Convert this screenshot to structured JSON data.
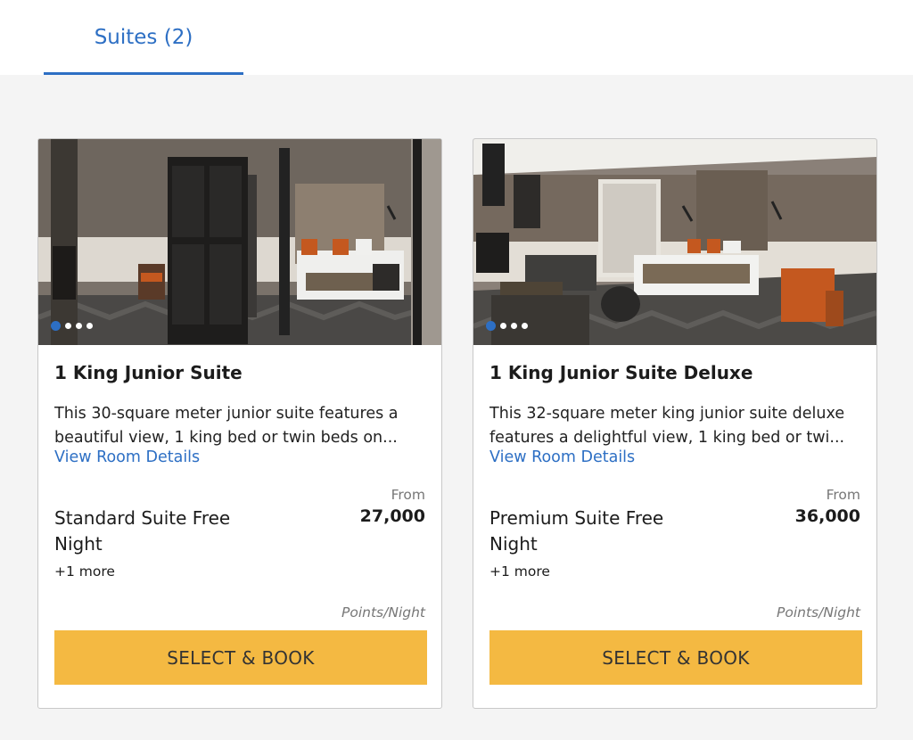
{
  "tab": {
    "label": "Suites (2)"
  },
  "rooms": [
    {
      "title": "1 King Junior Suite",
      "description_lines": [
        "This 30-square meter junior suite features a",
        "beautiful view, 1 king bed or twin beds on..."
      ],
      "details_link": "View Room Details",
      "from_label": "From",
      "price": "27,000",
      "rate_name": "Standard Suite Free Night",
      "more": "+1 more",
      "unit": "Points/Night",
      "button": "SELECT & BOOK"
    },
    {
      "title": "1 King Junior Suite Deluxe",
      "description_lines": [
        "This 32-square meter king junior suite deluxe",
        "features a delightful view, 1 king bed or twi..."
      ],
      "details_link": "View Room Details",
      "from_label": "From",
      "price": "36,000",
      "rate_name": "Premium Suite Free Night",
      "more": "+1 more",
      "unit": "Points/Night",
      "button": "SELECT & BOOK"
    }
  ],
  "colors": {
    "accent_blue": "#2d6fc4",
    "button_yellow": "#f4b942",
    "page_bg": "#f4f4f4"
  }
}
